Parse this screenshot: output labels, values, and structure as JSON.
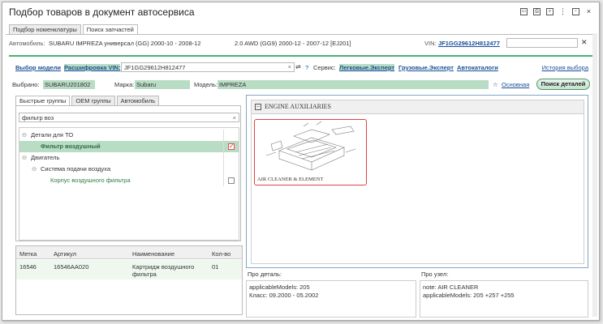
{
  "window": {
    "title": "Подбор товаров в документ автосервиса",
    "controls": [
      "save",
      "print",
      "preview",
      "more",
      "restore",
      "close"
    ]
  },
  "tabs": [
    {
      "label": "Подбор номенклатуры"
    },
    {
      "label": "Поиск запчастей"
    }
  ],
  "car": {
    "label": "Автомобиль:",
    "name": "SUBARU IMPREZA универсал (GG) 2000-10 - 2008-12",
    "engine": "2.0 AWD (GG9) 2000-12 - 2007-12 [EJ201]",
    "vin_label": "VIN:",
    "vin": "JF1GG29612H812477"
  },
  "model_row": {
    "choose_model": "Выбор модели",
    "decode_vin": "Расшифровка VIN:",
    "vin_input": "JF1GG29612H812477",
    "help": "?",
    "service_label": "Сервис:",
    "services": [
      "Легковые.Эксперт",
      "Грузовые.Эксперт",
      "Автокаталоги"
    ],
    "history": "История выбора"
  },
  "selection": {
    "selected_label": "Выбрано:",
    "selected": "SUBARU201802",
    "brand_label": "Марка:",
    "brand": "Subaru",
    "model_label": "Модель:",
    "model": "IMPREZA",
    "main": "Основная",
    "search_button": "Поиск деталей"
  },
  "left": {
    "tabs": [
      "Быстрые группы",
      "OEM группы",
      "Автомобиль"
    ],
    "filter": "фильтр воз",
    "tree": [
      {
        "label": "Детали для ТО",
        "level": 0
      },
      {
        "label": "Фильтр воздушный",
        "level": 1,
        "selected": true,
        "checked": true
      },
      {
        "label": "Двигатель",
        "level": 0
      },
      {
        "label": "Система подачи воздуха",
        "level": 1
      },
      {
        "label": "Корпус воздушного фильтра",
        "level": 2,
        "checked": false
      }
    ]
  },
  "grid": {
    "headers": [
      "Метка",
      "Артикул",
      "Наименование",
      "Кол-во"
    ],
    "rows": [
      [
        "16546",
        "16546AA020",
        "Картридж воздушного фильтра",
        "01"
      ]
    ]
  },
  "diagram": {
    "heading": "ENGINE AUXILIARIES",
    "card_label": "AIR CLEANER & ELEMENT"
  },
  "about_part": {
    "label": "Про деталь:",
    "lines": [
      "applicableModels: 205",
      "Класс: 09.2000 - 05.2002"
    ]
  },
  "about_node": {
    "label": "Про узел:",
    "lines": [
      "note: AIR CLEANER",
      "applicableModels: 205 +257 +255"
    ]
  },
  "colors": {
    "accent_green": "#4caf72",
    "highlight": "#b9dcc4",
    "link": "#1a4f9a"
  }
}
